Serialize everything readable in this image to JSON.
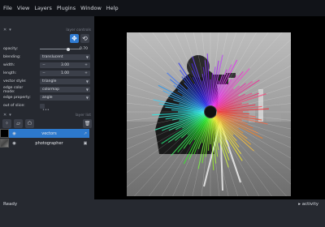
{
  "menubar": {
    "items": [
      "File",
      "View",
      "Layers",
      "Plugins",
      "Window",
      "Help"
    ]
  },
  "controls_dock": {
    "title": "layer controls"
  },
  "layer_controls": {
    "opacity_label": "opacity:",
    "opacity_value": "0.70",
    "opacity_fraction": 0.7,
    "blending_label": "blending:",
    "blending_value": "translucent",
    "width_label": "width:",
    "width_value": "3.00",
    "length_label": "length:",
    "length_value": "1.00",
    "vector_style_label": "vector style:",
    "vector_style_value": "triangle",
    "edge_color_mode_label": "edge color mode:",
    "edge_color_mode_value": "colormap",
    "edge_property_label": "edge property:",
    "edge_property_value": "angle",
    "out_of_slice_label": "out of slice:"
  },
  "list_dock": {
    "title": "layer list"
  },
  "layers": [
    {
      "name": "vectors",
      "selected": true
    },
    {
      "name": "photographer",
      "selected": false
    }
  ],
  "status": {
    "left": "Ready",
    "right": "activity"
  }
}
